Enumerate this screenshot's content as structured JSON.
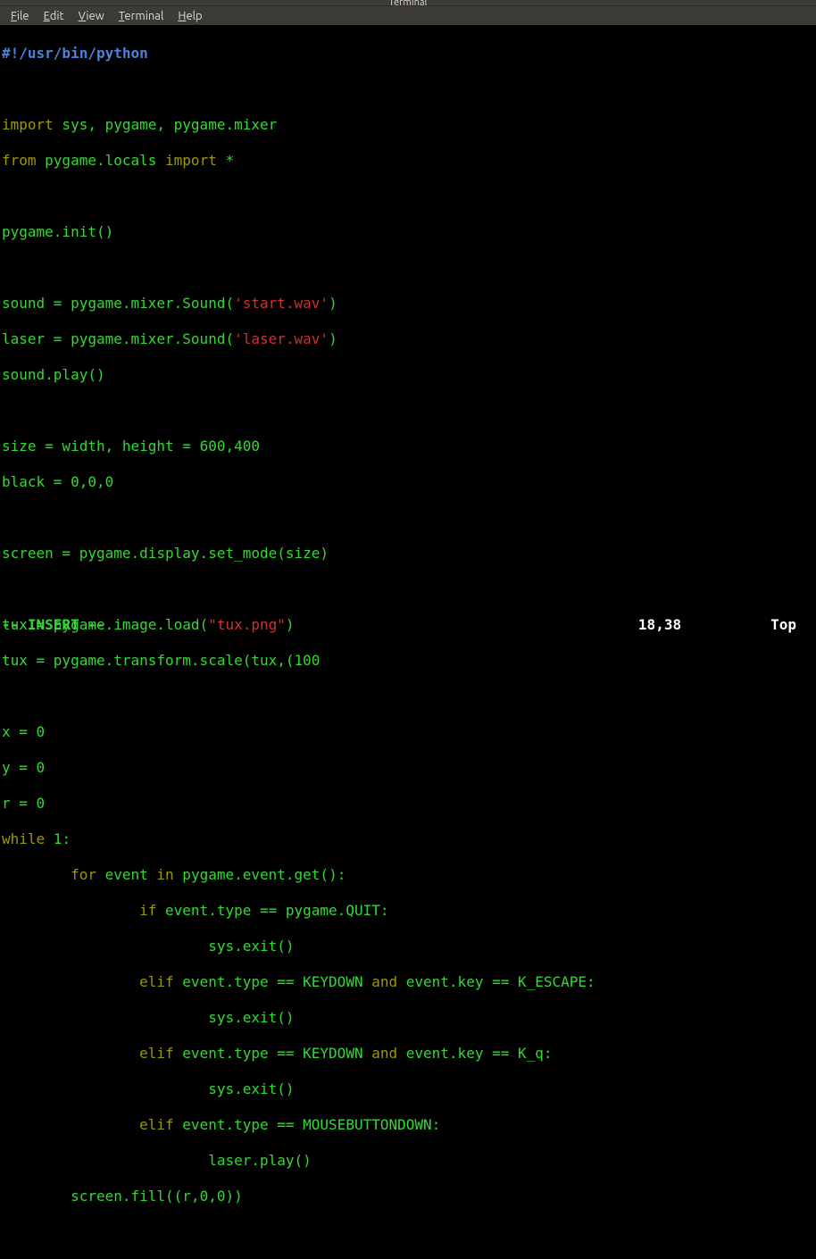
{
  "window": {
    "title": "Terminal"
  },
  "menubar": {
    "items": [
      {
        "label": "File",
        "accel": "F"
      },
      {
        "label": "Edit",
        "accel": "E"
      },
      {
        "label": "View",
        "accel": "V"
      },
      {
        "label": "Terminal",
        "accel": "T"
      },
      {
        "label": "Help",
        "accel": "H"
      }
    ]
  },
  "editor": {
    "mode": "-- INSERT --",
    "cursor_pos": "18,38",
    "scroll_pct": "Top",
    "code": {
      "shebang": "#!/usr/bin/python",
      "l3_kw1": "import",
      "l3_rest": " sys, pygame, pygame.mixer",
      "l4_kw1": "from",
      "l4_mid": " pygame.locals ",
      "l4_kw2": "import",
      "l4_rest": " *",
      "l6": "pygame.init()",
      "l8_a": "sound = pygame.mixer.Sound(",
      "l8_s": "'start.wav'",
      "l8_b": ")",
      "l9_a": "laser = pygame.mixer.Sound(",
      "l9_s": "'laser.wav'",
      "l9_b": ")",
      "l10": "sound.play()",
      "l12_a": "size = width, height = ",
      "l12_n": "600,400",
      "l13_a": "black = ",
      "l13_n": "0,0,0",
      "l15": "screen = pygame.display.set_mode(size)",
      "l17_a": "tux = pygame.image.load(",
      "l17_s": "\"tux.png\"",
      "l17_b": ")",
      "l18_a": "tux = pygame.transform.scale(tux,(",
      "l18_n": "100",
      "l20_a": "x = ",
      "l20_n": "0",
      "l21_a": "y = ",
      "l21_n": "0",
      "l22_a": "r = ",
      "l22_n": "0",
      "l23_kw": "while",
      "l23_rest": " 1:",
      "l24_ind": "        ",
      "l24_kw": "for",
      "l24_mid": " event ",
      "l24_kw2": "in",
      "l24_rest": " pygame.event.get():",
      "l25_ind": "                ",
      "l25_kw": "if",
      "l25_rest": " event.type == pygame.QUIT:",
      "l26_ind": "                        ",
      "l26": "sys.exit()",
      "l27_ind": "                ",
      "l27_kw": "elif",
      "l27_mid": " event.type == KEYDOWN ",
      "l27_kw2": "and",
      "l27_rest": " event.key == K_ESCAPE:",
      "l28_ind": "                        ",
      "l28": "sys.exit()",
      "l29_ind": "                ",
      "l29_kw": "elif",
      "l29_mid": " event.type == KEYDOWN ",
      "l29_kw2": "and",
      "l29_rest": " event.key == K_q:",
      "l30_ind": "                        ",
      "l30": "sys.exit()",
      "l31_ind": "                ",
      "l31_kw": "elif",
      "l31_rest": " event.type == MOUSEBUTTONDOWN:",
      "l32_ind": "                        ",
      "l32": "laser.play()",
      "l33_ind": "        ",
      "l33_a": "screen.fill((r,",
      "l33_n": "0,0",
      "l33_b": "))"
    }
  }
}
